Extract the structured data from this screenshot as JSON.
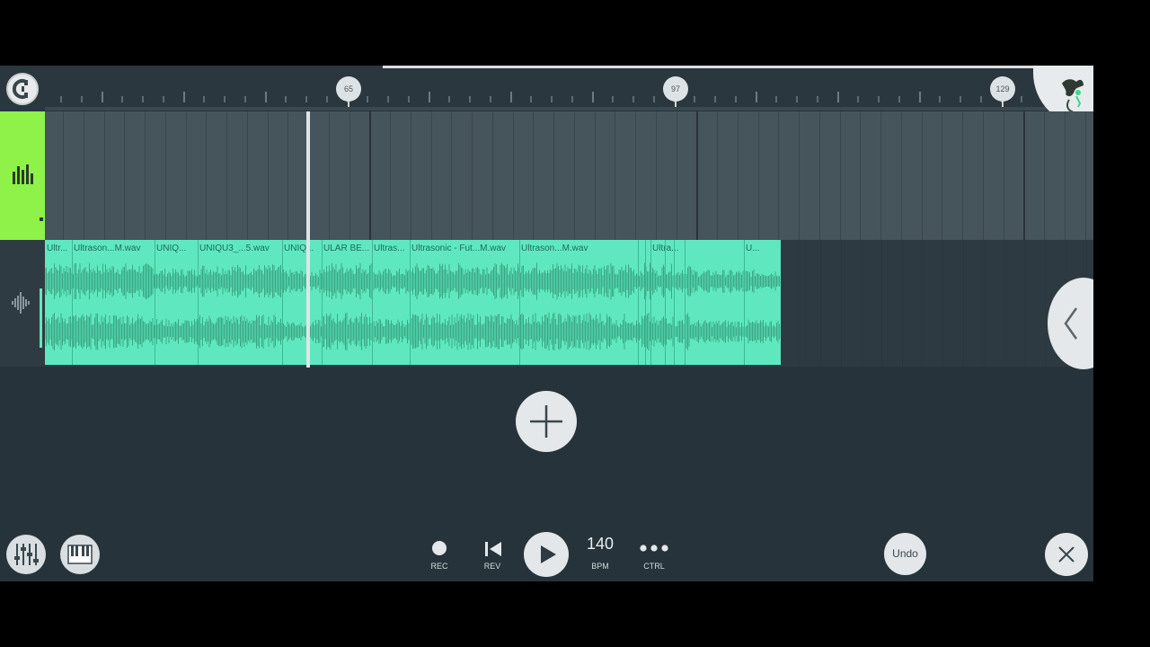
{
  "ruler": {
    "markers": [
      "65",
      "97",
      "129"
    ]
  },
  "clips": [
    {
      "label": "Ultr..."
    },
    {
      "label": "Ultrason...M.wav"
    },
    {
      "label": "UNIQ..."
    },
    {
      "label": "UNIQU3_...5.wav"
    },
    {
      "label": "UNIQ..."
    },
    {
      "label": "ULAR BE..."
    },
    {
      "label": "Ultras..."
    },
    {
      "label": "Ultrasonic - Fut...M.wav"
    },
    {
      "label": "Ultrason...M.wav"
    },
    {
      "label": "Ultra..."
    },
    {
      "label": "U..."
    }
  ],
  "transport": {
    "rec_label": "REC",
    "rev_label": "REV",
    "bpm_value": "140",
    "bpm_label": "BPM",
    "ctrl_label": "CTRL",
    "undo_label": "Undo"
  },
  "icons": [
    "magnet-icon",
    "app-logo-icon",
    "mixer-icon",
    "piano-icon",
    "record-icon",
    "rewind-icon",
    "play-icon",
    "more-icon",
    "close-icon",
    "add-icon",
    "chevron-left-icon",
    "channel-rack-icon",
    "audio-wave-icon"
  ],
  "colors": {
    "pattern_track": "#8ef248",
    "audio_clip": "#5fe8bf",
    "background": "#27333a"
  }
}
